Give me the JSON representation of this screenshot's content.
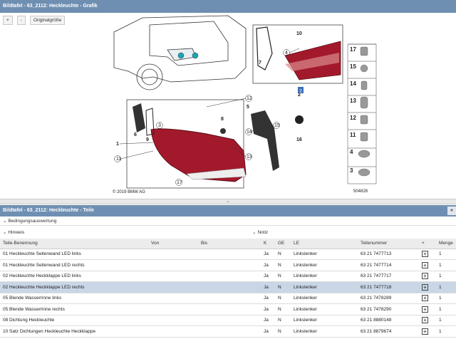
{
  "window_title": "Bildtafel - 63_2112: Heckleuchte - Grafik",
  "toolbar": {
    "zoom_in": "+",
    "zoom_out": "-",
    "original_size": "Originalgröße"
  },
  "graphic": {
    "copyright": "© 2019 BMW AG",
    "figure_number": "504828",
    "callouts": [
      "1",
      "2",
      "3",
      "4",
      "5",
      "6",
      "7",
      "8",
      "9",
      "10",
      "11",
      "12",
      "13",
      "14",
      "15",
      "16",
      "17"
    ],
    "legend_numbers": [
      "17",
      "15",
      "14",
      "13",
      "12",
      "11",
      "4",
      "3"
    ],
    "colors": {
      "lamp_red": "#a3192c",
      "lamp_dark": "#5c0d16",
      "highlight_teal": "#19a7b5",
      "selected_blue": "#3a6fb8"
    }
  },
  "parts_title": "Bildtafel - 63_2112: Heckleuchte - Teile",
  "collapse_icon": "«",
  "condition_label": "Bedingungsauswertung",
  "hinweis_label": "Hinweis",
  "notiz_label": "Notiz",
  "table": {
    "headers": [
      "Teile-Benennung",
      "Von",
      "Bis",
      "K",
      "GE",
      "LE",
      "Teilenummer",
      "+",
      "Menge"
    ],
    "rows": [
      [
        "01 Heckleuchte Seitenwand LED links",
        "",
        "",
        "Ja",
        "N",
        "Linkslenker",
        "63 21 7477713",
        "+",
        "1"
      ],
      [
        "01 Heckleuchte Seitenwand LED rechts",
        "",
        "",
        "Ja",
        "N",
        "Linkslenker",
        "63 21 7477714",
        "+",
        "1"
      ],
      [
        "02 Heckleuchte Heckklappe LED links",
        "",
        "",
        "Ja",
        "N",
        "Linkslenker",
        "63 21 7477717",
        "+",
        "1"
      ],
      [
        "02 Heckleuchte Heckklappe LED rechts",
        "",
        "",
        "Ja",
        "N",
        "Linkslenker",
        "63 21 7477718",
        "+",
        "1"
      ],
      [
        "05 Blende Wasserrinne links",
        "",
        "",
        "Ja",
        "N",
        "Linkslenker",
        "63 21 7478289",
        "+",
        "1"
      ],
      [
        "05 Blende Wasserrinne rechts",
        "",
        "",
        "Ja",
        "N",
        "Linkslenker",
        "63 21 7478290",
        "+",
        "1"
      ],
      [
        "08 Dichtung Heckleuchte",
        "",
        "",
        "Ja",
        "N",
        "Linkslenker",
        "63 21 8880148",
        "+",
        "1"
      ],
      [
        "10 Satz Dichtungen Heckleuchte Heckklappe",
        "",
        "",
        "Ja",
        "N",
        "Linkslenker",
        "63 21 8879674",
        "+",
        "1"
      ]
    ],
    "selected_row": 3
  }
}
